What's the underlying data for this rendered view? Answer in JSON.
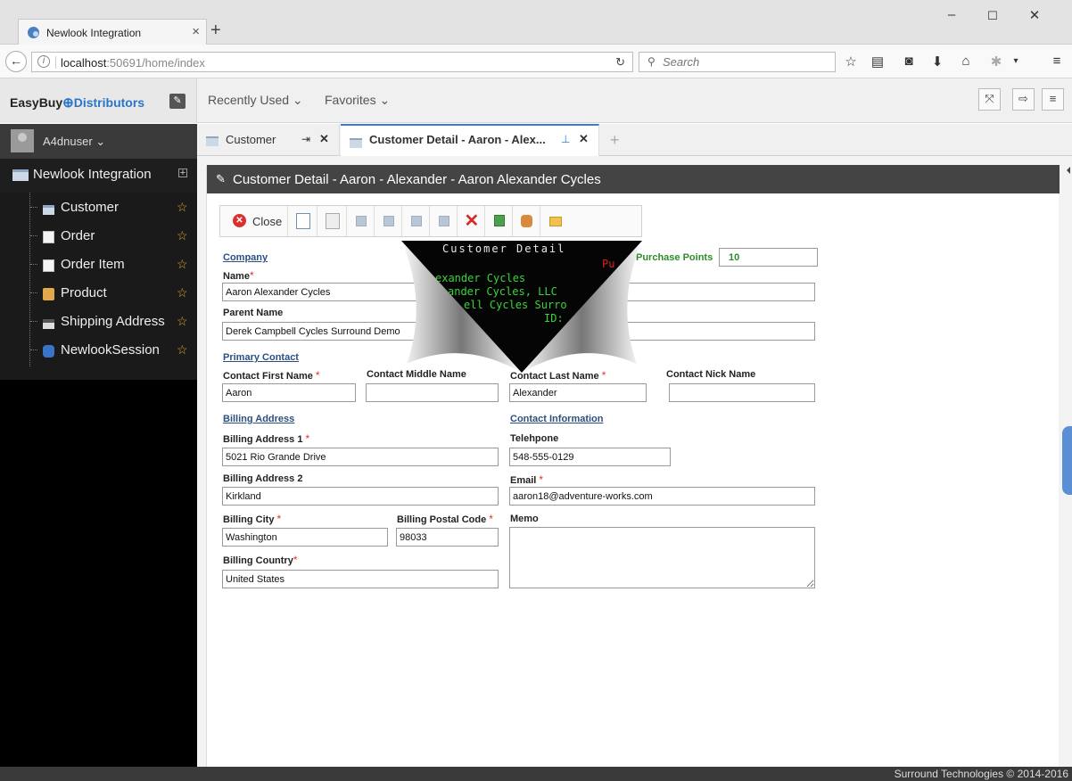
{
  "browser": {
    "tab_title": "Newlook Integration",
    "url_host": "localhost",
    "url_path": ":50691/home/index",
    "search_placeholder": "Search"
  },
  "app": {
    "logo_text_1": "EasyBuy",
    "logo_text_2": "Distributors",
    "menu_recent": "Recently Used ⌄",
    "menu_favorites": "Favorites ⌄"
  },
  "sidebar": {
    "username": "A4dnuser ⌄",
    "root": "Newlook Integration",
    "items": [
      {
        "label": "Customer",
        "icon": "folder-icon"
      },
      {
        "label": "Order",
        "icon": "document-icon"
      },
      {
        "label": "Order Item",
        "icon": "document-icon"
      },
      {
        "label": "Product",
        "icon": "product-icon"
      },
      {
        "label": "Shipping Address",
        "icon": "address-icon"
      },
      {
        "label": "NewlookSession",
        "icon": "session-icon"
      }
    ]
  },
  "tabs": [
    {
      "label": "Customer"
    },
    {
      "label": "Customer Detail - Aaron - Alex..."
    }
  ],
  "panel": {
    "title": "Customer Detail - Aaron - Alexander - Aaron Alexander Cycles",
    "close_label": "Close"
  },
  "form": {
    "company_section": "Company",
    "name_label": "Name",
    "name_value": "Aaron Alexander Cycles",
    "parent_label": "Parent Name",
    "parent_value": "Derek Campbell Cycles Surround Demo",
    "purchase_points_label": "Purchase Points",
    "purchase_points_value": "10",
    "primary_section": "Primary Contact",
    "first_label": "Contact First Name",
    "first_value": "Aaron",
    "middle_label": "Contact Middle Name",
    "middle_value": "",
    "last_label": "Contact Last Name",
    "last_value": "Alexander",
    "nick_label": "Contact Nick Name",
    "nick_value": "",
    "billing_section": "Billing Address",
    "addr1_label": "Billing Address 1",
    "addr1_value": "5021 Rio Grande Drive",
    "addr2_label": "Billing Address 2",
    "addr2_value": "Kirkland",
    "city_label": "Billing City",
    "city_value": "Washington",
    "postal_label": "Billing Postal Code",
    "postal_value": "98033",
    "country_label": "Billing Country",
    "country_value": "United States",
    "contact_section": "Contact Information",
    "phone_label": "Telehpone",
    "phone_value": "548-555-0129",
    "email_label": "Email",
    "email_value": "aaron18@adventure-works.com",
    "memo_label": "Memo"
  },
  "overlay": {
    "line1": "Customer Detail",
    "line2": "Pu",
    "line3": "exander Cycles",
    "line4": "ander Cycles, LLC",
    "line5": "ell Cycles Surro",
    "line6": "ID:"
  },
  "footer": {
    "copyright": "Surround Technologies © 2014-2016"
  },
  "colors": {
    "accent": "#2b75c8",
    "required": "#e03030",
    "section": "#2b4f80",
    "sidebar_bg": "#000000",
    "panel_header": "#444444"
  }
}
